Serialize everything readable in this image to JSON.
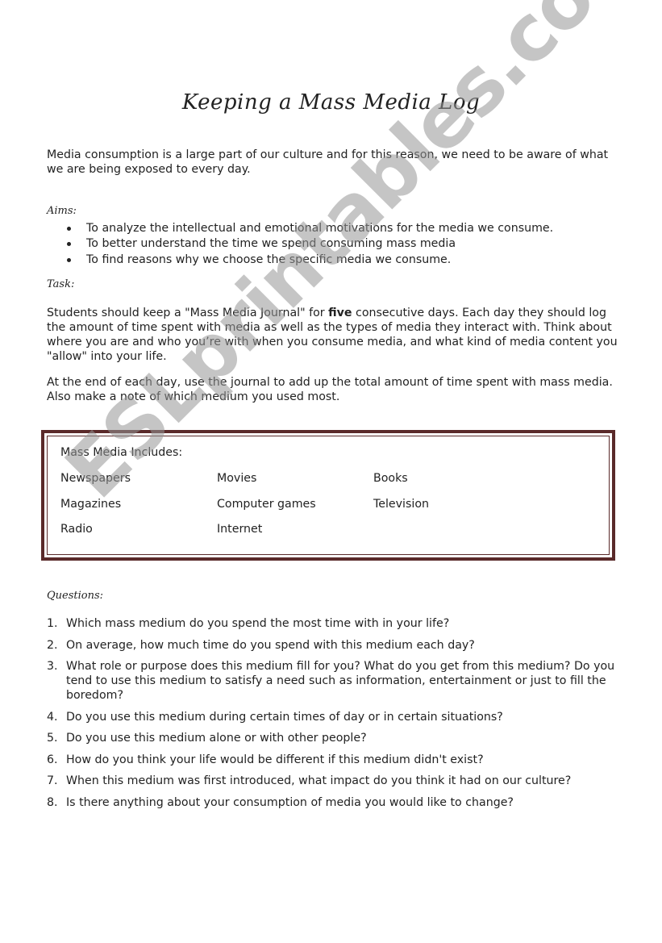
{
  "title": "Keeping a Mass Media Log",
  "intro": "Media consumption is a large part of our culture and for this reason, we need to be aware of what we are being exposed to every day.",
  "aims": {
    "heading": "Aims:",
    "items": [
      "To analyze the intellectual and emotional motivations for the media we consume.",
      "To better understand the time we spend consuming mass media",
      "To find reasons why we choose the specific media we consume."
    ]
  },
  "task": {
    "heading": "Task:",
    "p1_before": "Students should keep a \"Mass Media Journal\" for ",
    "p1_bold": "five",
    "p1_after": " consecutive days. Each day they should log the amount of time spent with media as well as the types of media they interact with. Think about where you are and who you’re with when you consume media, and what kind of media content you \"allow\" into your life.",
    "p2": "At the end of each day, use the journal to add up the total amount of time spent with mass media. Also make a note of which medium you used most."
  },
  "media_box": {
    "title": "Mass Media Includes:",
    "items": [
      [
        "Newspapers",
        "Movies",
        "Books"
      ],
      [
        "Magazines",
        "Computer games",
        "Television"
      ],
      [
        "Radio",
        "Internet",
        ""
      ]
    ]
  },
  "questions": {
    "heading": "Questions:",
    "items": [
      {
        "num": "1.",
        "text": "Which mass medium do you spend the most time with in your life?"
      },
      {
        "num": "2.",
        "text": "On average, how much time do you spend with this medium each day?"
      },
      {
        "num": "3.",
        "text": "What role or purpose does this medium fill for you? What do you get from this medium? Do you tend to use this medium to satisfy a need such as information, entertainment or just to fill the boredom?"
      },
      {
        "num": "4.",
        "text": "Do you use this medium during certain times of day or in certain situations?"
      },
      {
        "num": "5.",
        "text": "Do you use this medium alone or with other people?"
      },
      {
        "num": "6.",
        "text": "How do you think your life would be different if this medium didn't exist?"
      },
      {
        "num": "7.",
        "text": "When this medium was first introduced, what impact do you think it had on our culture?"
      },
      {
        "num": "8.",
        "text": "Is there anything about your consumption of media you would like to change?"
      }
    ]
  },
  "watermark": "ESLprintables.com",
  "colors": {
    "box_border": "#5a2a2a",
    "watermark": "#969696"
  }
}
